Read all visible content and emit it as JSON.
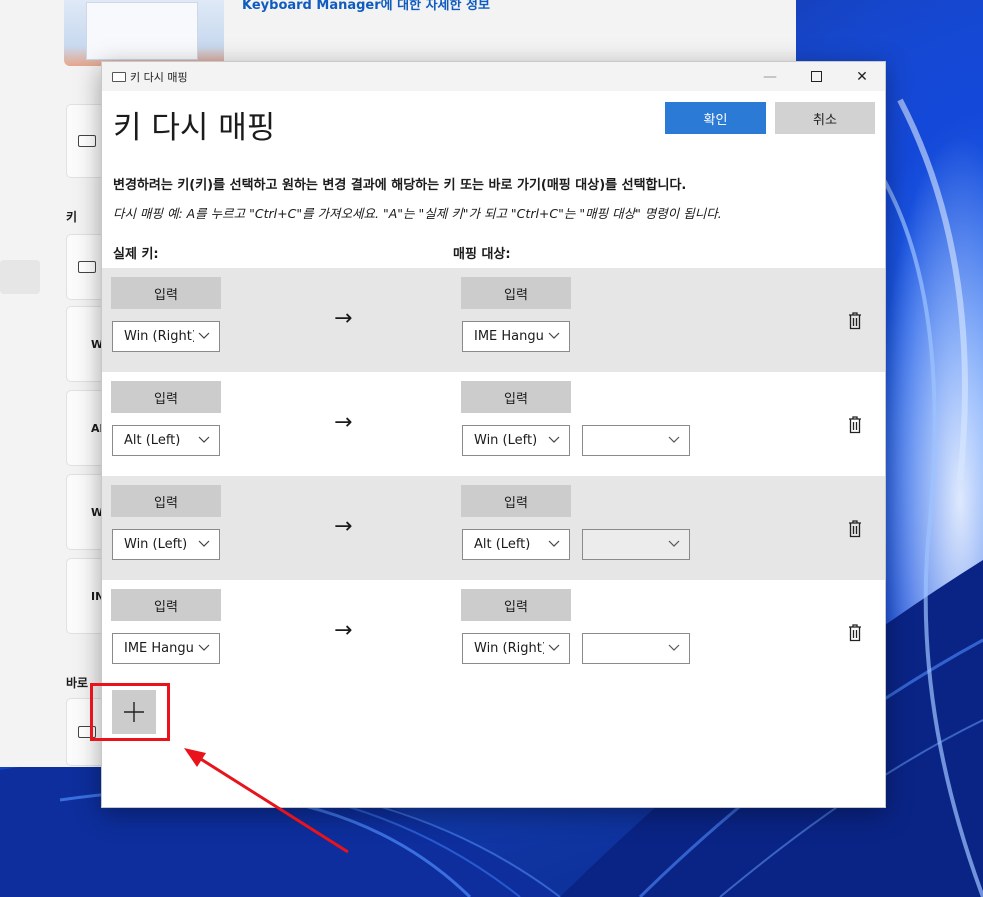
{
  "background_window": {
    "link": "Keyboard Manager에 대한 자세한 정보",
    "section_keys_label": "키",
    "section_shortcuts_label": "바로",
    "cards": [
      "W",
      "Al",
      "W",
      "IN"
    ]
  },
  "dialog": {
    "window_title": "키 다시 매핑",
    "heading": "키 다시 매핑",
    "ok_label": "확인",
    "cancel_label": "취소",
    "instruction": "변경하려는 키(키)를 선택하고 원하는 변경 결과에 해당하는 키 또는 바로 가기(매핑 대상)를 선택합니다.",
    "example": "다시 매핑 예: A를 누르고 \"Ctrl+C\"를 가져오세요. \"A\"는 \"실제 키\"가 되고 \"Ctrl+C\"는 \"매핑 대상\" 명령이 됩니다.",
    "col_actual": "실제 키:",
    "col_target": "매핑 대상:",
    "input_label": "입력",
    "arrow": "→",
    "rows": [
      {
        "actual": "Win (Right)",
        "target": "IME Hangul",
        "extra": null
      },
      {
        "actual": "Alt (Left)",
        "target": "Win (Left)",
        "extra": ""
      },
      {
        "actual": "Win (Left)",
        "target": "Alt (Left)",
        "extra": ""
      },
      {
        "actual": "IME Hangul",
        "target": "Win (Right)",
        "extra": ""
      }
    ],
    "add_button": "+"
  },
  "icons": {
    "title_icon": "keyboard-icon",
    "delete": "trash-icon",
    "dropdown": "chevron-down-icon",
    "add": "plus-icon"
  },
  "colors": {
    "accent": "#2b7ad6",
    "annotation": "#e8131b"
  }
}
